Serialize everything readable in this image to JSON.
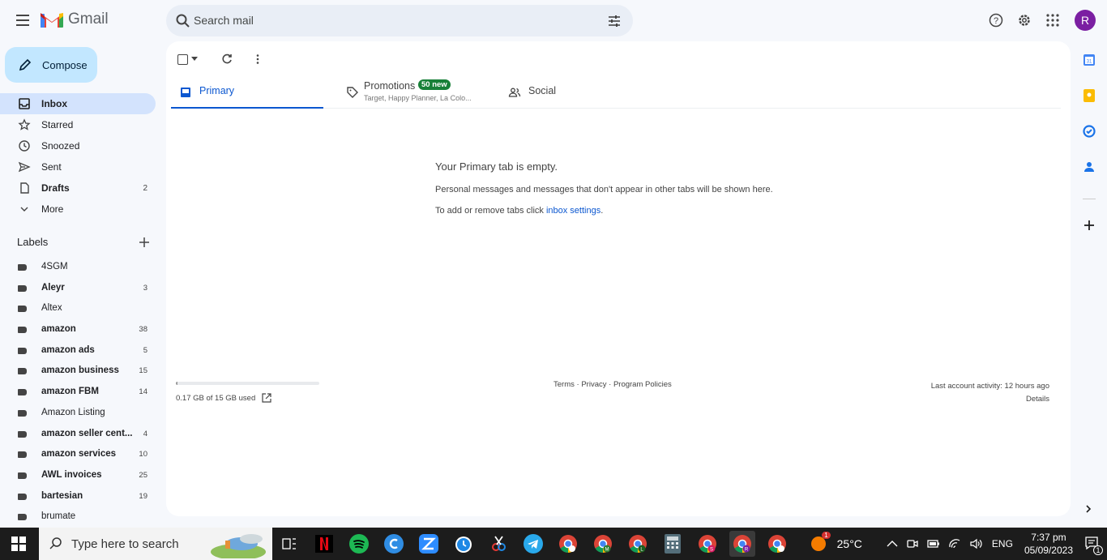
{
  "header": {
    "app_name": "Gmail",
    "search_placeholder": "Search mail",
    "avatar_letter": "R"
  },
  "compose_label": "Compose",
  "nav": {
    "items": [
      {
        "label": "Inbox",
        "count": "",
        "bold": true
      },
      {
        "label": "Starred",
        "count": "",
        "bold": false
      },
      {
        "label": "Snoozed",
        "count": "",
        "bold": false
      },
      {
        "label": "Sent",
        "count": "",
        "bold": false
      },
      {
        "label": "Drafts",
        "count": "2",
        "bold": true
      },
      {
        "label": "More",
        "count": "",
        "bold": false
      }
    ]
  },
  "labels_heading": "Labels",
  "labels": [
    {
      "label": "4SGM",
      "count": ""
    },
    {
      "label": "Aleyr",
      "count": "3"
    },
    {
      "label": "Altex",
      "count": ""
    },
    {
      "label": "amazon",
      "count": "38"
    },
    {
      "label": "amazon ads",
      "count": "5"
    },
    {
      "label": "amazon business",
      "count": "15"
    },
    {
      "label": "amazon FBM",
      "count": "14"
    },
    {
      "label": "Amazon Listing",
      "count": ""
    },
    {
      "label": "amazon seller cent...",
      "count": "4"
    },
    {
      "label": "amazon services",
      "count": "10"
    },
    {
      "label": "AWL invoices",
      "count": "25"
    },
    {
      "label": "bartesian",
      "count": "19"
    },
    {
      "label": "brumate",
      "count": ""
    }
  ],
  "tabs": {
    "primary": "Primary",
    "promotions": "Promotions",
    "promotions_badge": "50 new",
    "promotions_sub": "Target, Happy Planner, La Colo...",
    "social": "Social"
  },
  "empty": {
    "title": "Your Primary tab is empty.",
    "line1": "Personal messages and messages that don't appear in other tabs will be shown here.",
    "line2_prefix": "To add or remove tabs click ",
    "line2_link": "inbox settings",
    "line2_suffix": "."
  },
  "footer": {
    "storage": "0.17 GB of 15 GB used",
    "storage_fraction": 0.011,
    "terms": "Terms",
    "privacy": "Privacy",
    "policies": "Program Policies",
    "last_activity": "Last account activity: 12 hours ago",
    "details": "Details"
  },
  "taskbar": {
    "search_placeholder": "Type here to search",
    "weather": "25°C",
    "weather_badge": "1",
    "language": "ENG",
    "time": "7:37 pm",
    "date": "05/09/2023",
    "notification_count": "1"
  },
  "colors": {
    "accent": "#0b57d0",
    "compose_bg": "#c2e7ff",
    "active_nav": "#d3e3fd",
    "badge_green": "#188038",
    "avatar": "#7b1fa2"
  }
}
